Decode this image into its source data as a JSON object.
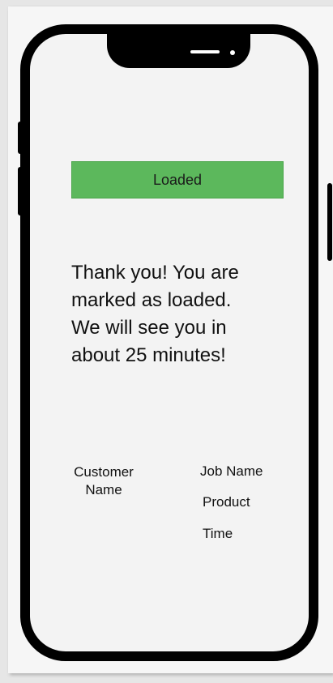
{
  "status": {
    "label": "Loaded",
    "color": "#5cb85c"
  },
  "message": {
    "lines": [
      "Thank you! You are",
      "marked as loaded.",
      "We will see you in",
      "about 25 minutes!"
    ]
  },
  "details": {
    "customer_name_line1": "Customer",
    "customer_name_line2": "Name",
    "job_name": "Job Name",
    "product": "Product",
    "time": "Time"
  }
}
